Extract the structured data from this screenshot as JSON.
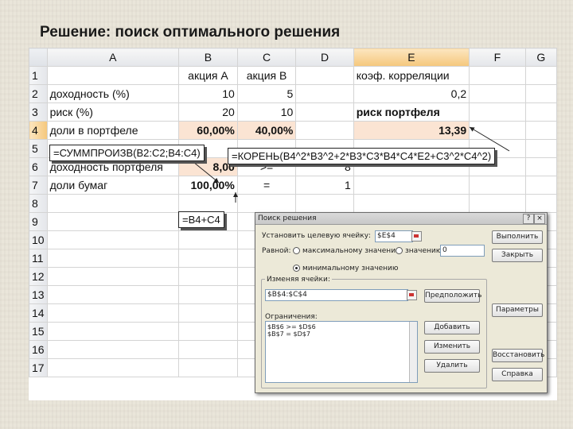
{
  "title": "Решение: поиск оптимального решения",
  "columns": [
    "A",
    "B",
    "C",
    "D",
    "E",
    "F",
    "G"
  ],
  "rows": [
    {
      "n": "1",
      "cells": [
        "",
        "акция А",
        "акция В",
        "",
        "коэф. корреляции",
        "",
        ""
      ]
    },
    {
      "n": "2",
      "cells": [
        "доходность (%)",
        "10",
        "5",
        "",
        "0,2",
        "",
        ""
      ]
    },
    {
      "n": "3",
      "cells": [
        "риск (%)",
        "20",
        "10",
        "",
        "риск портфеля",
        "",
        ""
      ]
    },
    {
      "n": "4",
      "cells": [
        "доли в портфеле",
        "60,00%",
        "40,00%",
        "",
        "13,39",
        "",
        ""
      ]
    },
    {
      "n": "5",
      "cells": [
        "",
        "",
        "",
        "",
        "",
        "",
        ""
      ]
    },
    {
      "n": "6",
      "cells": [
        "доходность портфеля",
        "8,00",
        ">=",
        "8",
        "",
        "",
        ""
      ]
    },
    {
      "n": "7",
      "cells": [
        "доли бумаг",
        "100,00%",
        "=",
        "1",
        "",
        "",
        ""
      ]
    },
    {
      "n": "8",
      "cells": [
        "",
        "",
        "",
        "",
        "",
        "",
        ""
      ]
    },
    {
      "n": "9",
      "cells": [
        "",
        "",
        "",
        "",
        "",
        "",
        ""
      ]
    },
    {
      "n": "10",
      "cells": [
        "",
        "",
        "",
        "",
        "",
        "",
        ""
      ]
    },
    {
      "n": "11",
      "cells": [
        "",
        "",
        "",
        "",
        "",
        "",
        ""
      ]
    },
    {
      "n": "12",
      "cells": [
        "",
        "",
        "",
        "",
        "",
        "",
        ""
      ]
    },
    {
      "n": "13",
      "cells": [
        "",
        "",
        "",
        "",
        "",
        "",
        ""
      ]
    },
    {
      "n": "14",
      "cells": [
        "",
        "",
        "",
        "",
        "",
        "",
        ""
      ]
    },
    {
      "n": "15",
      "cells": [
        "",
        "",
        "",
        "",
        "",
        "",
        ""
      ]
    },
    {
      "n": "16",
      "cells": [
        "",
        "",
        "",
        "",
        "",
        "",
        ""
      ]
    },
    {
      "n": "17",
      "cells": [
        "",
        "",
        "",
        "",
        "",
        "",
        ""
      ]
    }
  ],
  "callouts": {
    "sumproduct": "=СУММПРОИЗВ(B2:C2;B4:C4)",
    "root": "=КОРЕНЬ(B4^2*B3^2+2*B3*C3*B4*C4*E2+C3^2*C4^2)",
    "sum": "=B4+C4"
  },
  "dialog": {
    "title": "Поиск решения",
    "target_label": "Установить целевую ячейку:",
    "target_value": "$E$4",
    "equal_label": "Равной:",
    "opt_max": "максимальному значению",
    "opt_value": "значению:",
    "value_field": "0",
    "opt_min": "минимальному значению",
    "changing_label": "Изменяя ячейки:",
    "changing_value": "$B$4:$C$4",
    "constraints_label": "Ограничения:",
    "constraints": [
      "$B$6 >= $D$6",
      "$B$7 = $D$7"
    ],
    "btn_execute": "Выполнить",
    "btn_close": "Закрыть",
    "btn_guess": "Предположить",
    "btn_params": "Параметры",
    "btn_add": "Добавить",
    "btn_change": "Изменить",
    "btn_delete": "Удалить",
    "btn_restore": "Восстановить",
    "btn_help": "Справка",
    "close_glyph": "×",
    "help_glyph": "?"
  }
}
